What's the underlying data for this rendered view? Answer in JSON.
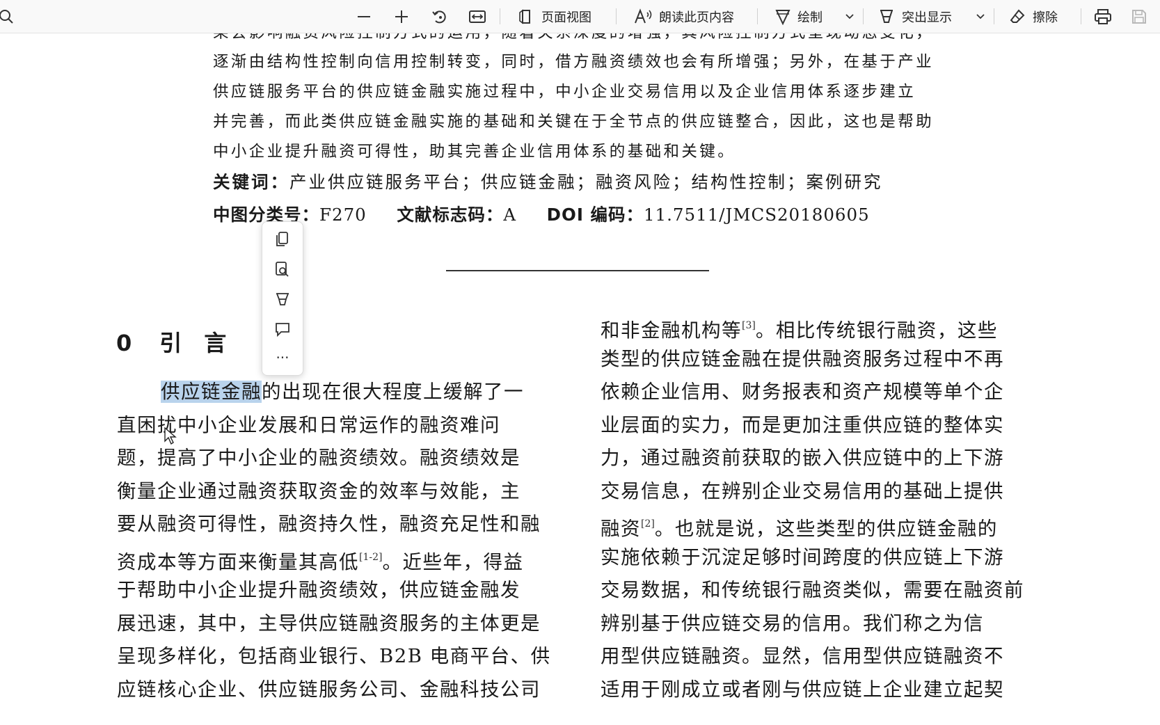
{
  "toolbar": {
    "page_view": "页面视图",
    "read_aloud": "朗读此页内容",
    "draw": "绘制",
    "highlight": "突出显示",
    "erase": "擦除"
  },
  "abstract_lines": [
    "果会影响融资风险控制方式的运用，随着关系深度的增强，其风险控制方式呈现动态变化，",
    "逐渐由结构性控制向信用控制转变，同时，借方融资绩效也会有所增强；另外，在基于产业",
    "供应链服务平台的供应链金融实施过程中，中小企业交易信用以及企业信用体系逐步建立",
    "并完善，而此类供应链金融实施的基础和关键在于全节点的供应链整合，因此，这也是帮助",
    "中小企业提升融资可得性，助其完善企业信用体系的基础和关键。"
  ],
  "keywords": {
    "label": "关键词：",
    "text": "产业供应链服务平台；供应链金融；融资风险；结构性控制；案例研究"
  },
  "classification": {
    "clc_label": "中图分类号：",
    "clc_value": "F270",
    "doc_label": "文献标志码：",
    "doc_value": "A",
    "doi_label": "DOI 编码：",
    "doi_value": "11.7511/JMCS20180605"
  },
  "section": {
    "number": "0",
    "title": "引　言"
  },
  "left_column": {
    "highlighted": "供应链金融",
    "first_rest": "的出现在很大程度上缓解了一",
    "lines": [
      "直困扰中小企业发展和日常运作的融资难问",
      "题，提高了中小企业的融资绩效。融资绩效是",
      "衡量企业通过融资获取资金的效率与效能，主",
      "要从融资可得性，融资持久性，融资充足性和融"
    ],
    "ref_line_pre": "资成本等方面来衡量其高低",
    "ref_1": "[1-2]",
    "ref_line_post": "。近些年，得益",
    "lines_after": [
      "于帮助中小企业提升融资绩效，供应链金融发",
      "展迅速，其中，主导供应链融资服务的主体更是",
      "呈现多样化，包括商业银行、B2B 电商平台、供",
      "应链核心企业、供应链服务公司、金融科技公司"
    ]
  },
  "right_column": {
    "first_pre": "和非金融机构等",
    "ref_3": "[3]",
    "first_post": "。相比传统银行融资，这些",
    "lines_a": [
      "类型的供应链金融在提供融资服务过程中不再",
      "依赖企业信用、财务报表和资产规模等单个企",
      "业层面的实力，而是更加注重供应链的整体实",
      "力，通过融资前获取的嵌入供应链中的上下游",
      "交易信息，在辨别企业交易信用的基础上提供"
    ],
    "ref2_pre": "融资",
    "ref_2": "[2]",
    "ref2_post": "。也就是说，这些类型的供应链金融的",
    "lines_b": [
      "实施依赖于沉淀足够时间跨度的供应链上下游",
      "交易数据，和传统银行融资类似，需要在融资前",
      "辨别基于供应链交易的信用。我们称之为信",
      "用型供应链融资。显然，信用型供应链融资不",
      "适用于刚成立或者刚与供应链上企业建立起契"
    ]
  },
  "context_menu": {
    "items": [
      "copy-icon",
      "search-selection-icon",
      "highlight-icon",
      "comment-icon",
      "more-icon"
    ],
    "more_label": "···"
  }
}
